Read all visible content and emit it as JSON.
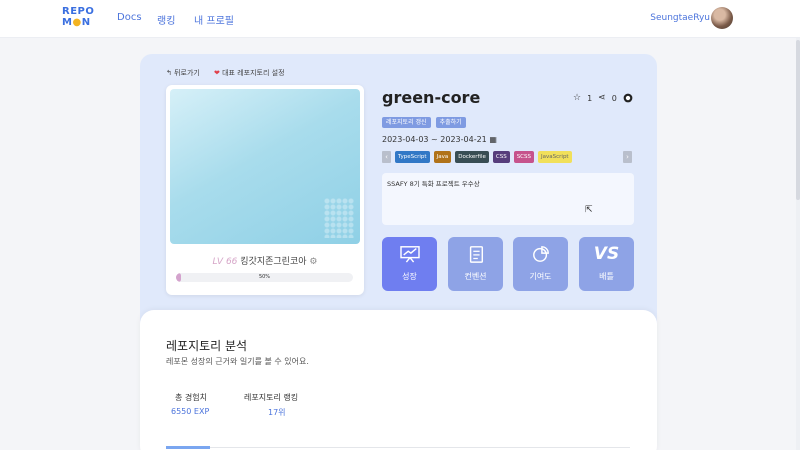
{
  "nav": {
    "logo_line1": "REPO",
    "logo_line2_a": "M",
    "logo_line2_b": "N",
    "links": [
      "Docs",
      "랭킹",
      "내 프로필"
    ],
    "username": "SeungtaeRyu"
  },
  "repo": {
    "back_label": "뒤로가기",
    "favorite_label": "대표 레포지토리 설정",
    "level_prefix": "LV",
    "level": "66",
    "character_name": "킹갓지존그린코아",
    "exp_percent": 50,
    "exp_text": "50%",
    "title": "green-core",
    "stars": "1",
    "forks": "0",
    "tags": [
      "레포지토리 갱신",
      "추출하기"
    ],
    "date_range": "2023-04-03  ~  2023-04-21",
    "languages": [
      {
        "name": "TypeScript",
        "color": "#3178c6"
      },
      {
        "name": "Java",
        "color": "#b07219"
      },
      {
        "name": "Dockerfile",
        "color": "#384d54"
      },
      {
        "name": "CSS",
        "color": "#563d7c"
      },
      {
        "name": "SCSS",
        "color": "#c6538c"
      },
      {
        "name": "JavaScript",
        "color": "#f1e05a"
      }
    ],
    "description": "SSAFY 8기 특화 프로젝트 우수상",
    "buttons": [
      {
        "label": "성장",
        "color": "#6f7ef0",
        "icon": "growth-chart-icon"
      },
      {
        "label": "컨벤션",
        "color": "#8ea3e6",
        "icon": "clipboard-icon"
      },
      {
        "label": "기여도",
        "color": "#8ea3e6",
        "icon": "pie-chart-icon"
      },
      {
        "label": "배틀",
        "color": "#8ea3e6",
        "icon": "vs-icon"
      }
    ],
    "vs_text": "VS"
  },
  "analysis": {
    "title": "레포지토리 분석",
    "subtitle": "레포몬 성장의 근거와 일기를 볼 수 있어요.",
    "total_exp_label": "총 경험치",
    "total_exp_value": "6550 EXP",
    "ranking_label": "레포지토리 랭킹",
    "ranking_value": "17위"
  }
}
